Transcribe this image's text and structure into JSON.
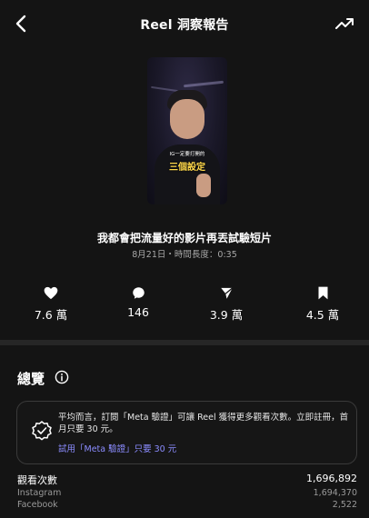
{
  "header": {
    "title": "Reel 洞察報告"
  },
  "icons": {
    "back": "chevron-left-icon",
    "trend": "trending-up-icon",
    "like": "heart-icon",
    "comment": "comment-bubble-icon",
    "share": "send-icon",
    "save": "bookmark-icon",
    "info": "info-icon",
    "verified": "verified-badge-icon"
  },
  "thumbnail": {
    "caption_small": "IG一定要打開的",
    "caption_big": "三個設定"
  },
  "video": {
    "title": "我都會把流量好的影片再丟試驗短片",
    "meta": "8月21日・時間長度：0:35"
  },
  "stats": {
    "likes": "7.6 萬",
    "comments": "146",
    "shares": "3.9 萬",
    "saves": "4.5 萬"
  },
  "overview": {
    "title": "總覽"
  },
  "promo": {
    "text": "平均而言，訂閱「Meta 驗證」可讓 Reel 獲得更多觀看次數。立即註冊，首月只要 30 元。",
    "link": "試用「Meta 驗證」只要 30 元"
  },
  "views": {
    "label": "觀看次數",
    "total": "1,696,892",
    "rows": [
      {
        "label": "Instagram",
        "value": "1,694,370"
      },
      {
        "label": "Facebook",
        "value": "2,522"
      }
    ]
  },
  "colors": {
    "background": "#141414",
    "accent_link": "#8b8cff",
    "divider": "#262626"
  }
}
